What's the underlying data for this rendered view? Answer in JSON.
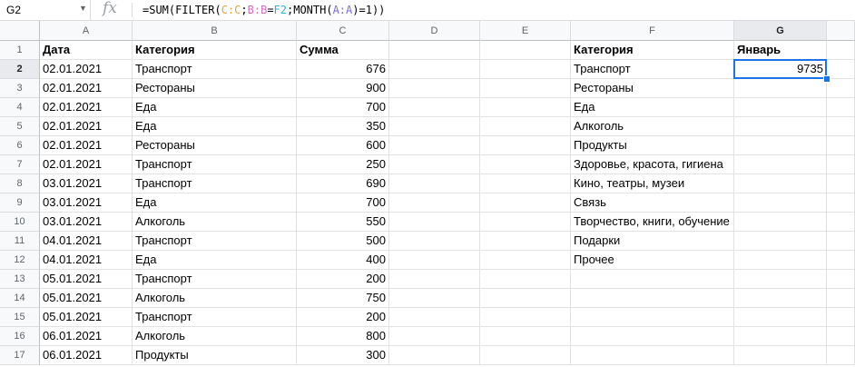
{
  "formula_bar": {
    "name_box": "G2",
    "fx_icon": "fx",
    "formula_parts": [
      {
        "t": "=SUM(FILTER(",
        "c": "#000000"
      },
      {
        "t": "C:C",
        "c": "#e8a33c"
      },
      {
        "t": ";",
        "c": "#000000"
      },
      {
        "t": "B:B",
        "c": "#d26bc7"
      },
      {
        "t": "=",
        "c": "#000000"
      },
      {
        "t": "F2",
        "c": "#2db0d6"
      },
      {
        "t": ";MONTH(",
        "c": "#000000"
      },
      {
        "t": "A:A",
        "c": "#7b6bd6"
      },
      {
        "t": ")=1))",
        "c": "#000000"
      }
    ]
  },
  "columns": [
    "A",
    "B",
    "C",
    "D",
    "E",
    "F",
    "G"
  ],
  "active_column": "G",
  "active_row": 2,
  "rows": [
    {
      "n": "1",
      "a": "Дата",
      "b": "Категория",
      "c": "Сумма",
      "f": "Категория",
      "g": "Январь"
    },
    {
      "n": "2",
      "a": "02.01.2021",
      "b": "Транспорт",
      "c": "676",
      "f": "Транспорт",
      "g": "9735"
    },
    {
      "n": "3",
      "a": "02.01.2021",
      "b": "Рестораны",
      "c": "900",
      "f": "Рестораны",
      "g": ""
    },
    {
      "n": "4",
      "a": "02.01.2021",
      "b": "Еда",
      "c": "700",
      "f": "Еда",
      "g": ""
    },
    {
      "n": "5",
      "a": "02.01.2021",
      "b": "Еда",
      "c": "350",
      "f": "Алкоголь",
      "g": ""
    },
    {
      "n": "6",
      "a": "02.01.2021",
      "b": "Рестораны",
      "c": "600",
      "f": "Продукты",
      "g": ""
    },
    {
      "n": "7",
      "a": "02.01.2021",
      "b": "Транспорт",
      "c": "250",
      "f": "Здоровье, красота, гигиена",
      "g": ""
    },
    {
      "n": "8",
      "a": "03.01.2021",
      "b": "Транспорт",
      "c": "690",
      "f": "Кино, театры, музеи",
      "g": ""
    },
    {
      "n": "9",
      "a": "03.01.2021",
      "b": "Еда",
      "c": "700",
      "f": "Связь",
      "g": ""
    },
    {
      "n": "10",
      "a": "03.01.2021",
      "b": "Алкоголь",
      "c": "550",
      "f": "Творчество, книги, обучение",
      "g": ""
    },
    {
      "n": "11",
      "a": "04.01.2021",
      "b": "Транспорт",
      "c": "500",
      "f": "Подарки",
      "g": ""
    },
    {
      "n": "12",
      "a": "04.01.2021",
      "b": "Еда",
      "c": "400",
      "f": "Прочее",
      "g": ""
    },
    {
      "n": "13",
      "a": "05.01.2021",
      "b": "Транспорт",
      "c": "200",
      "f": "",
      "g": ""
    },
    {
      "n": "14",
      "a": "05.01.2021",
      "b": "Алкоголь",
      "c": "750",
      "f": "",
      "g": ""
    },
    {
      "n": "15",
      "a": "05.01.2021",
      "b": "Транспорт",
      "c": "200",
      "f": "",
      "g": ""
    },
    {
      "n": "16",
      "a": "06.01.2021",
      "b": "Алкоголь",
      "c": "800",
      "f": "",
      "g": ""
    },
    {
      "n": "17",
      "a": "06.01.2021",
      "b": "Продукты",
      "c": "300",
      "f": "",
      "g": ""
    }
  ]
}
